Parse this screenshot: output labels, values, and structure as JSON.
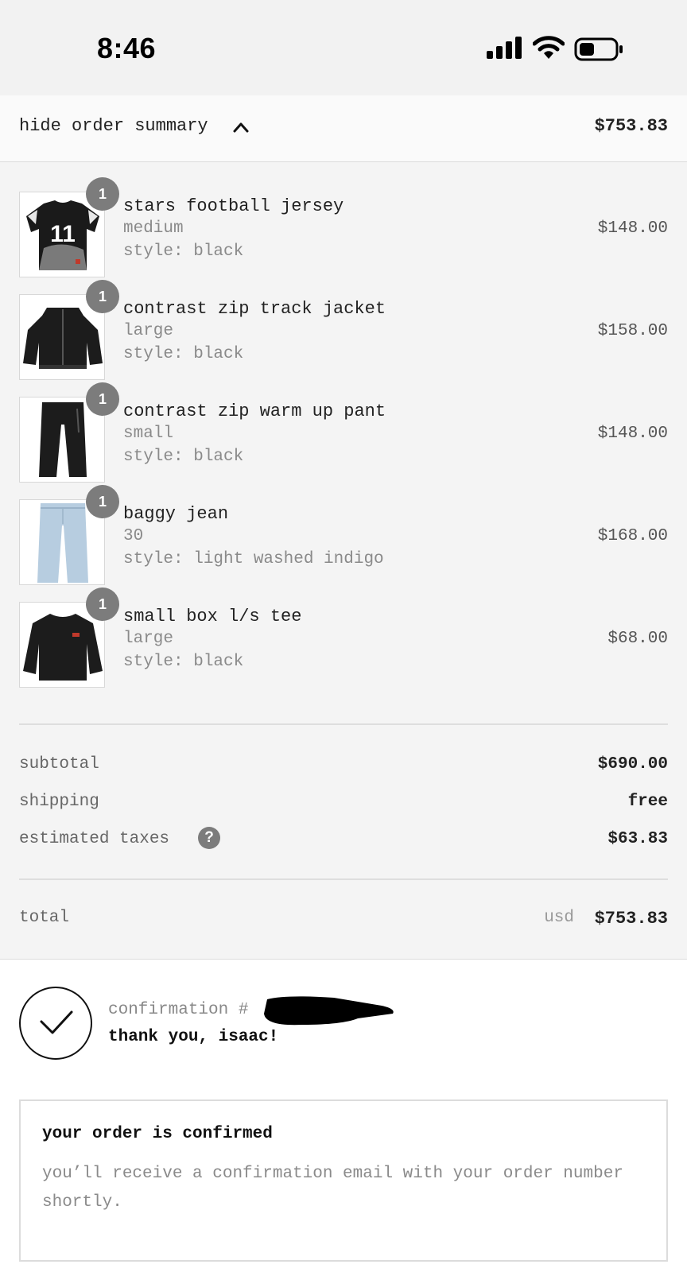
{
  "status_bar": {
    "time": "8:46"
  },
  "summary_header": {
    "toggle_label": "hide order summary",
    "total": "$753.83"
  },
  "items": [
    {
      "name": "stars football jersey",
      "variant": "medium",
      "style": "style: black",
      "price": "$148.00",
      "quantity": "1"
    },
    {
      "name": "contrast zip track jacket",
      "variant": "large",
      "style": "style: black",
      "price": "$158.00",
      "quantity": "1"
    },
    {
      "name": "contrast zip warm up pant",
      "variant": "small",
      "style": "style: black",
      "price": "$148.00",
      "quantity": "1"
    },
    {
      "name": "baggy jean",
      "variant": "30",
      "style": "style: light washed indigo",
      "price": "$168.00",
      "quantity": "1"
    },
    {
      "name": "small box l/s tee",
      "variant": "large",
      "style": "style: black",
      "price": "$68.00",
      "quantity": "1"
    }
  ],
  "totals": {
    "subtotal_label": "subtotal",
    "subtotal": "$690.00",
    "shipping_label": "shipping",
    "shipping": "free",
    "taxes_label": "estimated taxes",
    "taxes": "$63.83",
    "help_symbol": "?",
    "total_label": "total",
    "currency": "usd",
    "total": "$753.83"
  },
  "confirmation": {
    "number_label": "confirmation #",
    "thanks": "thank you, isaac!",
    "box_title": "your order is confirmed",
    "box_text": "you’ll receive a confirmation email with your order number shortly."
  },
  "colors": {
    "background": "#f4f4f4",
    "badge": "#7c7c7c",
    "muted_text": "#8a8a8a"
  }
}
